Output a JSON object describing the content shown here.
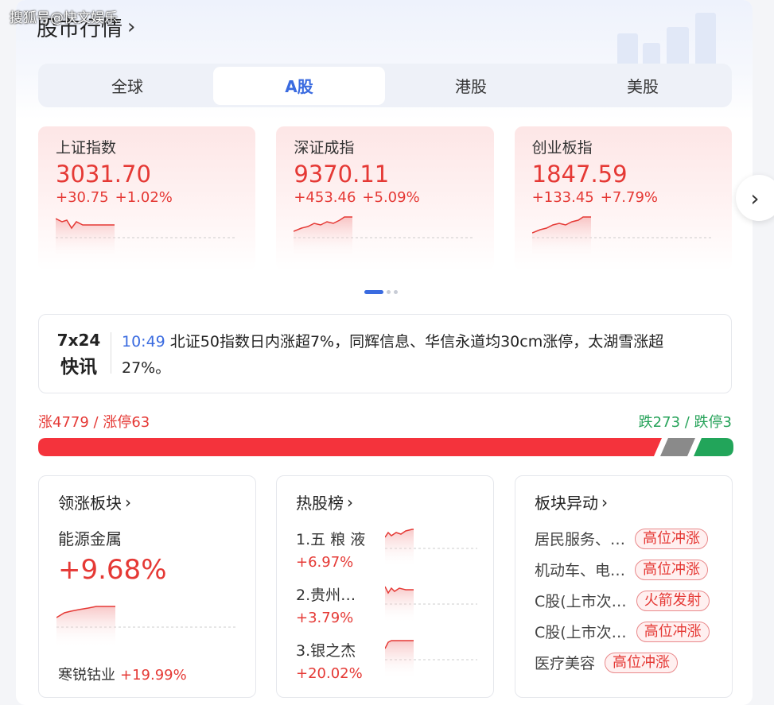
{
  "watermark": "搜狐号@快文娱乐",
  "title": "股市行情",
  "tabs": [
    "全球",
    "A股",
    "港股",
    "美股"
  ],
  "active_tab": "A股",
  "indices": [
    {
      "name": "上证指数",
      "value": "3031.70",
      "change": "+30.75",
      "pct": "+1.02%"
    },
    {
      "name": "深证成指",
      "value": "9370.11",
      "change": "+453.46",
      "pct": "+5.09%"
    },
    {
      "name": "创业板指",
      "value": "1847.59",
      "change": "+133.45",
      "pct": "+7.79%"
    }
  ],
  "news": {
    "tag_line1": "7x24",
    "tag_line2": "快讯",
    "time": "10:49",
    "text": "北证50指数日内涨超7%，同辉信息、华信永道均30cm涨停，太湖雪涨超27%。"
  },
  "breadth": {
    "up_label": "涨4779 / 涨停63",
    "down_label": "跌273 / 跌停3"
  },
  "leading_sector": {
    "title": "领涨板块",
    "name": "能源金属",
    "pct": "+9.68%",
    "top_stock": "寒锐钴业",
    "top_stock_pct": "+19.99%"
  },
  "hot_stocks": {
    "title": "热股榜",
    "items": [
      {
        "name": "1.五 粮 液",
        "pct": "+6.97%"
      },
      {
        "name": "2.贵州…",
        "pct": "+3.79%"
      },
      {
        "name": "3.银之杰",
        "pct": "+20.02%"
      }
    ]
  },
  "sector_moves": {
    "title": "板块异动",
    "items": [
      {
        "name": "居民服务、…",
        "badge": "高位冲涨"
      },
      {
        "name": "机动车、电…",
        "badge": "高位冲涨"
      },
      {
        "name": "C股(上市次…",
        "badge": "火箭发射"
      },
      {
        "name": "C股(上市次…",
        "badge": "高位冲涨"
      },
      {
        "name": "医疗美容",
        "badge": "高位冲涨"
      }
    ]
  },
  "colors": {
    "up": "#e53935",
    "down": "#27a35a",
    "accent": "#3a6be0",
    "flat": "#8a8a8a"
  }
}
